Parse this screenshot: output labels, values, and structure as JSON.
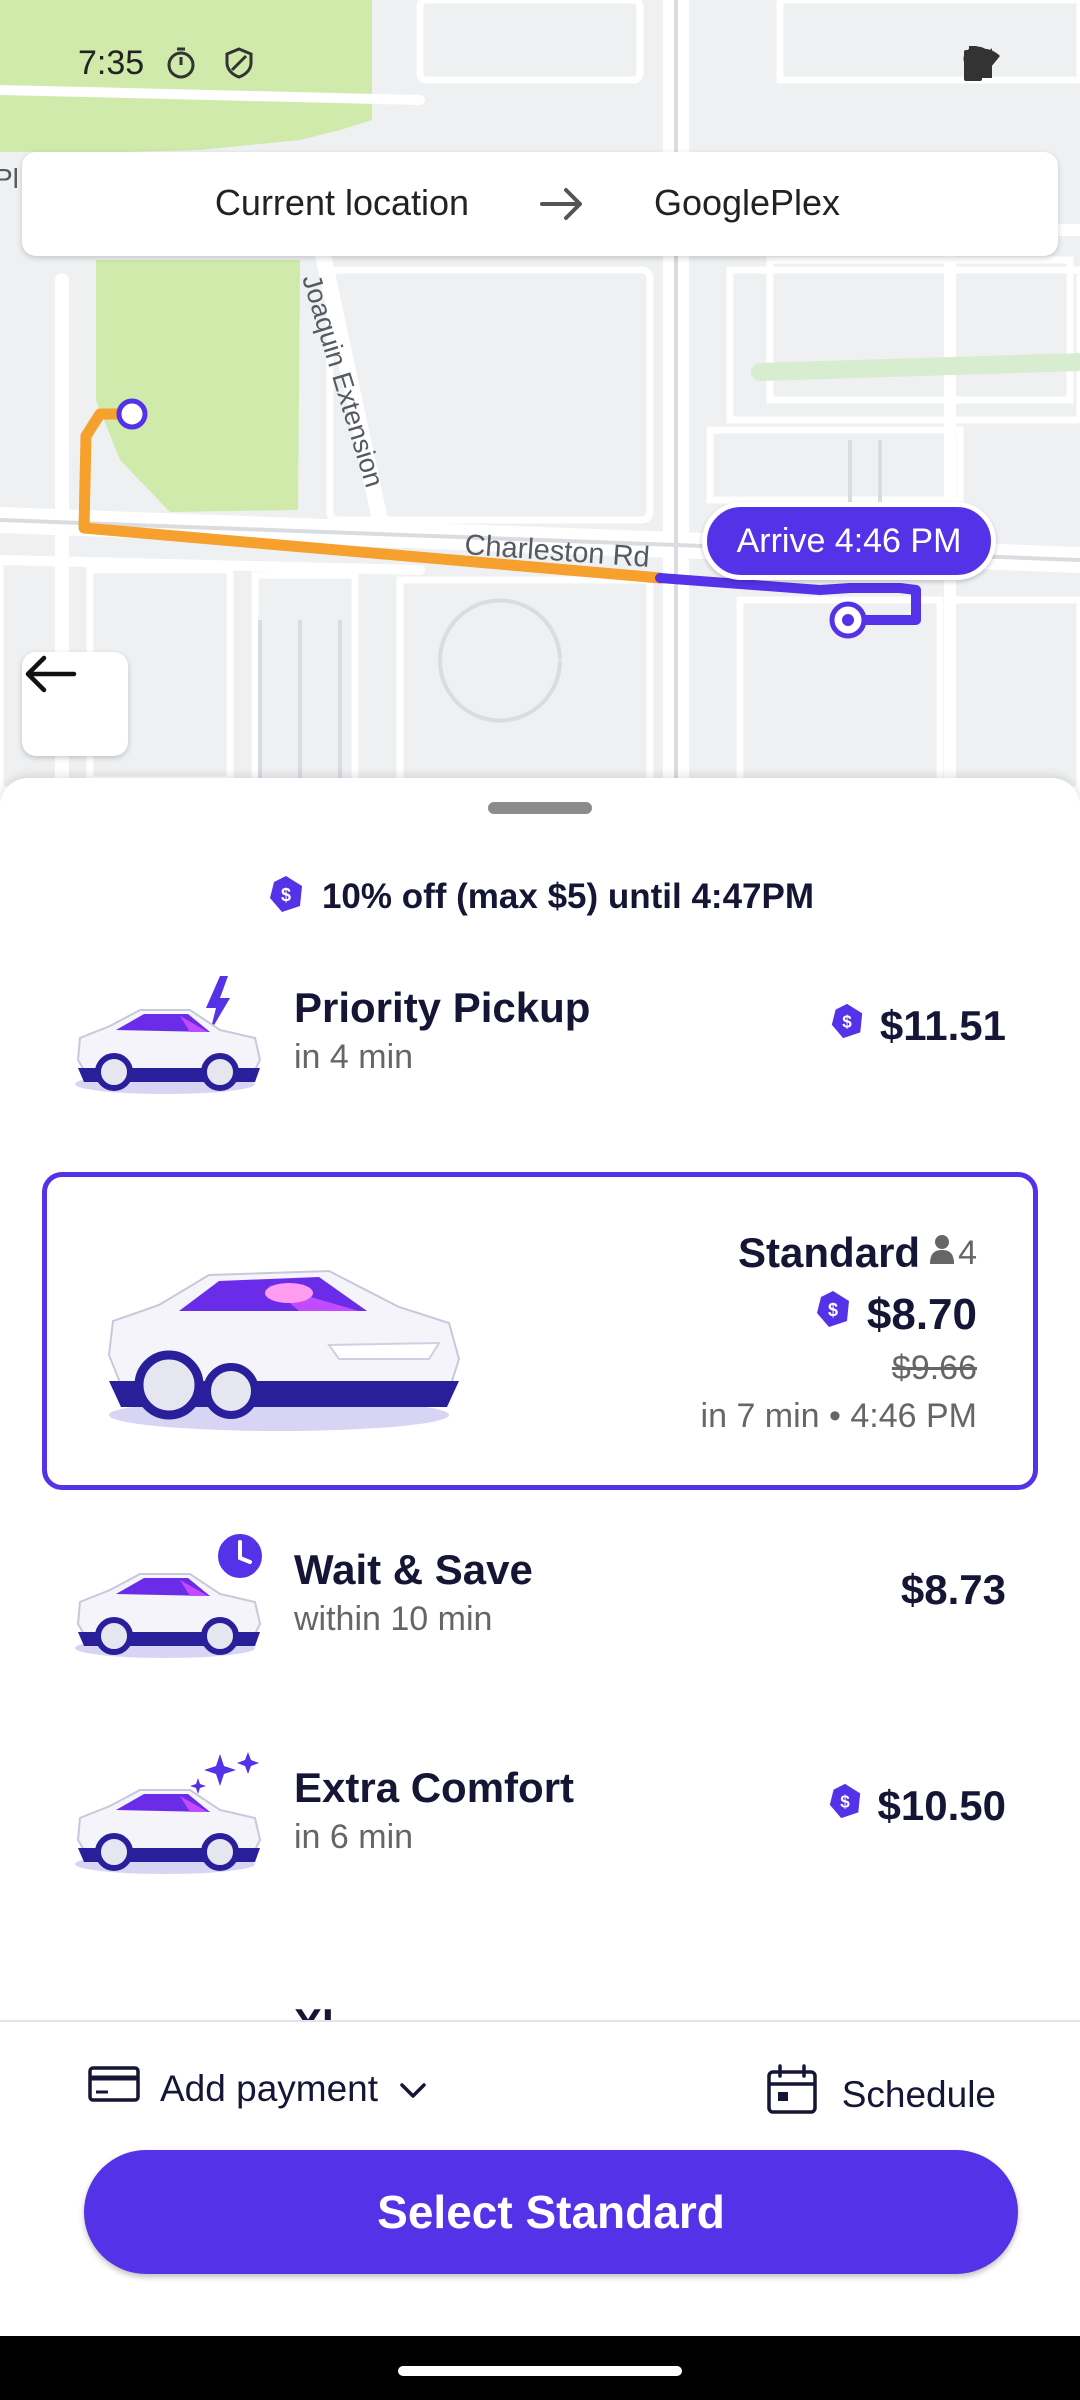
{
  "status_bar": {
    "time": "7:35"
  },
  "route": {
    "from": "Current location",
    "to": "GooglePlex"
  },
  "map": {
    "street_labels": [
      "Joaquin Extension",
      "Charleston Rd"
    ],
    "arrival_label": "Arrive 4:46 PM",
    "edge_label": "Pl"
  },
  "promo": {
    "text": "10% off (max $5) until 4:47PM"
  },
  "options": [
    {
      "title": "Priority Pickup",
      "eta": "in 4 min",
      "price": "$11.51",
      "discounted": true
    },
    {
      "title": "Wait & Save",
      "eta": "within 10 min",
      "price": "$8.73",
      "discounted": false
    },
    {
      "title": "Extra Comfort",
      "eta": "in 6 min",
      "price": "$10.50",
      "discounted": true
    },
    {
      "title": "XL"
    }
  ],
  "selected": {
    "title": "Standard",
    "capacity": "4",
    "price": "$8.70",
    "old_price": "$9.66",
    "eta": "in 7 min • 4:46 PM"
  },
  "footer": {
    "payment_label": "Add payment",
    "schedule_label": "Schedule",
    "cta_label": "Select Standard"
  },
  "colors": {
    "accent": "#5432e8",
    "route_orange": "#f6a02d",
    "park_green": "#cfeaaa"
  }
}
